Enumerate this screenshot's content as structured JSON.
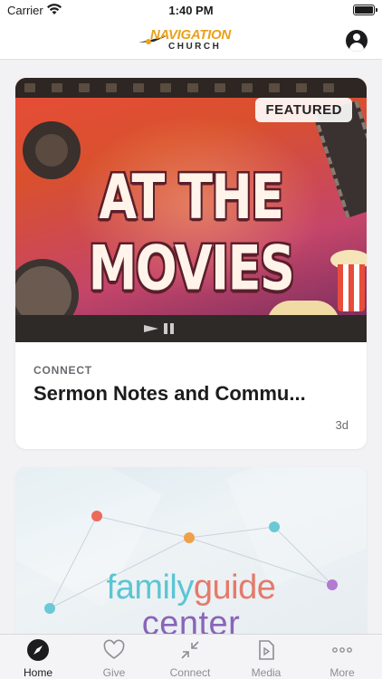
{
  "status_bar": {
    "carrier": "Carrier",
    "time": "1:40 PM"
  },
  "header": {
    "logo_top": "NAVIGATION",
    "logo_bottom": "CHURCH",
    "profile_icon": "person-circle-icon"
  },
  "feed": {
    "cards": [
      {
        "badge": "FEATURED",
        "image_title": "AT THE MOVIES",
        "category": "CONNECT",
        "title": "Sermon Notes and Commu...",
        "time": "3d"
      },
      {
        "image_text_1": "family",
        "image_text_2": "guide",
        "image_text_3": "center"
      }
    ]
  },
  "tab_bar": {
    "tabs": [
      {
        "label": "Home",
        "icon": "compass-icon",
        "active": true
      },
      {
        "label": "Give",
        "icon": "heart-icon",
        "active": false
      },
      {
        "label": "Connect",
        "icon": "arrows-in-icon",
        "active": false
      },
      {
        "label": "Media",
        "icon": "play-document-icon",
        "active": false
      },
      {
        "label": "More",
        "icon": "ellipsis-icon",
        "active": false
      }
    ]
  },
  "colors": {
    "accent_orange": "#e8a21c",
    "tab_inactive": "#8e8e93",
    "tab_active": "#1c1c1e"
  }
}
